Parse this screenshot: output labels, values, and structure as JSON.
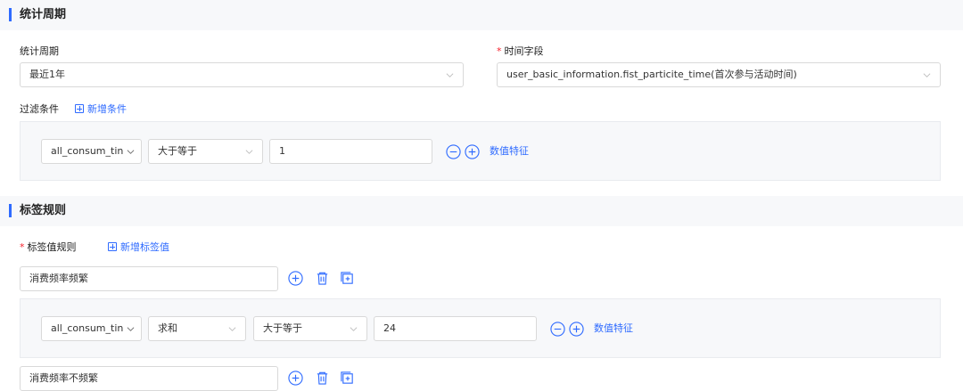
{
  "section1": {
    "title": "统计周期",
    "period_label": "统计周期",
    "period_value": "最近1年",
    "time_field_required": "*",
    "time_field_label": "时间字段",
    "time_field_value": "user_basic_information.fist_particite_time(首次参与活动时间)",
    "filter_label": "过滤条件",
    "add_condition": "新增条件",
    "filter_row": {
      "field": "all_consum_tin",
      "operator": "大于等于",
      "value": "1",
      "feature_link": "数值特征"
    }
  },
  "section2": {
    "title": "标签规则",
    "rule_required": "*",
    "rule_label": "标签值规则",
    "add_tag_value": "新增标签值",
    "tag_values": [
      {
        "name": "消费频率频繁",
        "condition": {
          "field": "all_consum_tin",
          "agg": "求和",
          "operator": "大于等于",
          "value": "24",
          "feature_link": "数值特征"
        }
      },
      {
        "name": "消费频率不频繁"
      }
    ]
  },
  "colors": {
    "accent": "#2f6bff",
    "required": "#f5222d",
    "panel_bg": "#f7f8fa",
    "border": "#d9d9d9"
  }
}
